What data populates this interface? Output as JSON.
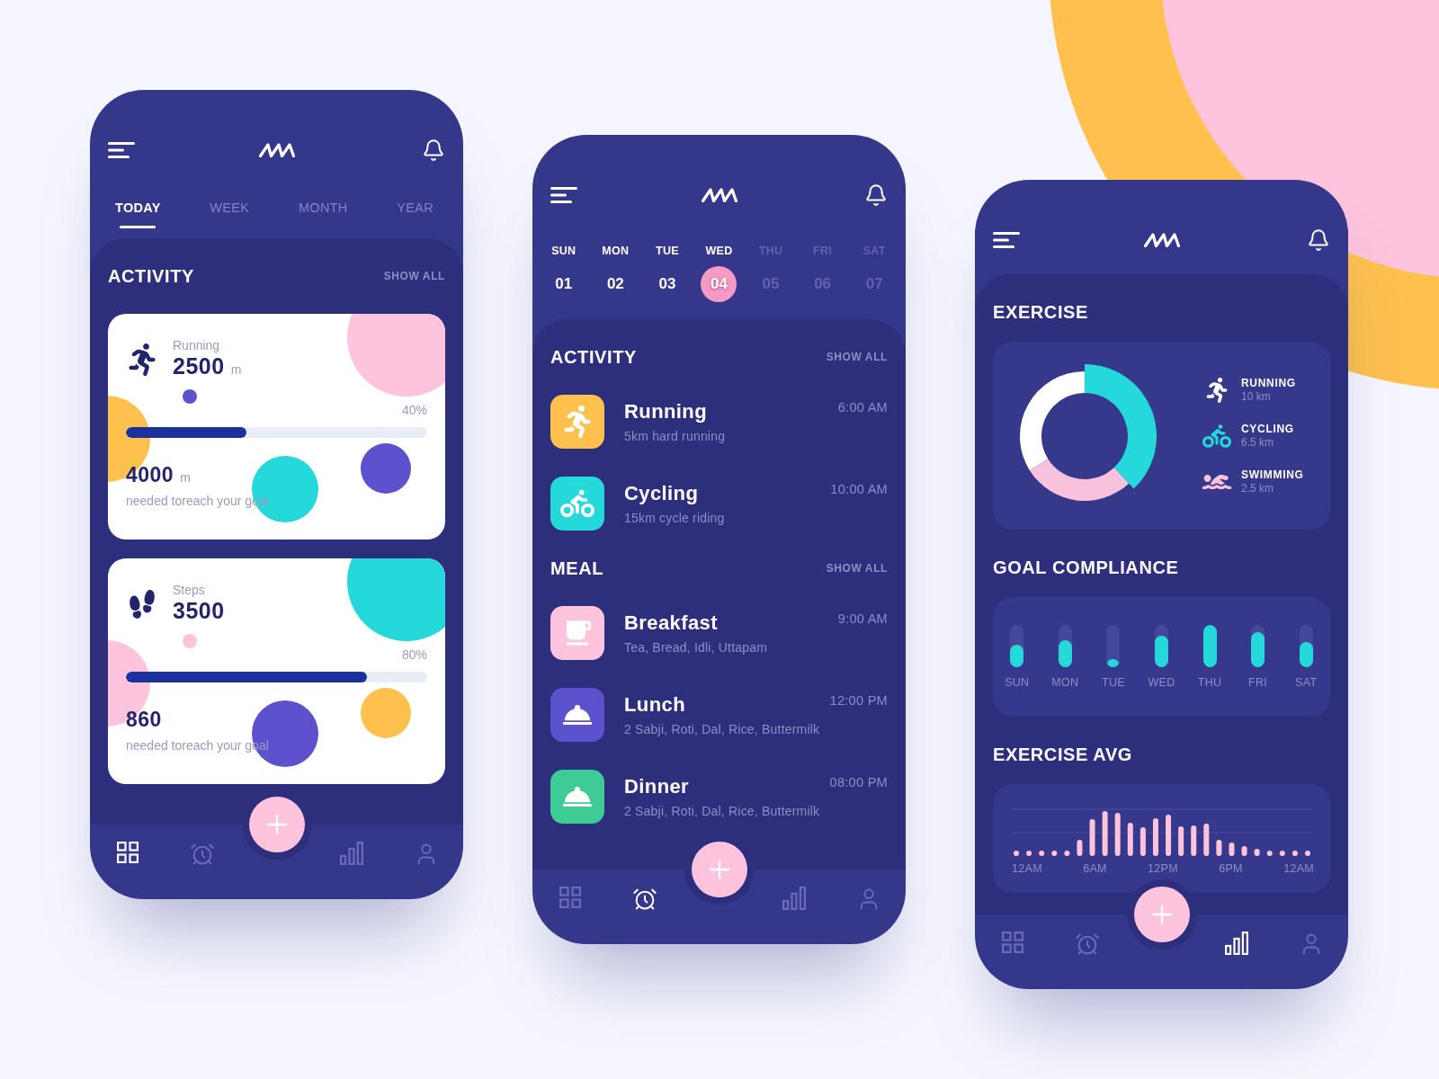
{
  "phones": [
    {
      "kind": "overview",
      "tabs": [
        {
          "label": "TODAY",
          "selected": true
        },
        {
          "label": "WEEK",
          "selected": false
        },
        {
          "label": "MONTH",
          "selected": false
        },
        {
          "label": "YEAR",
          "selected": false
        }
      ],
      "section": {
        "title": "ACTIVITY",
        "action": "SHOW ALL"
      },
      "cards": [
        {
          "label": "Running",
          "value": "2500",
          "unit": "m",
          "percent": "40%",
          "level": 0.4,
          "remaining": "4000",
          "remaining_unit": "m",
          "caption": "needed toreach your goal"
        },
        {
          "label": "Steps",
          "value": "3500",
          "percent": "80%",
          "level": 0.8,
          "remaining": "860",
          "caption": "needed toreach your goal"
        }
      ],
      "nav": [
        {
          "selected": true
        },
        {
          "selected": false
        },
        {
          "selected": false
        },
        {
          "selected": false
        }
      ]
    },
    {
      "kind": "schedule",
      "days": [
        {
          "name": "SUN",
          "date": "01",
          "selected": false,
          "dimmed": false
        },
        {
          "name": "MON",
          "date": "02",
          "selected": false,
          "dimmed": false
        },
        {
          "name": "TUE",
          "date": "03",
          "selected": false,
          "dimmed": false
        },
        {
          "name": "WED",
          "date": "04",
          "selected": true,
          "dimmed": false
        },
        {
          "name": "THU",
          "date": "05",
          "selected": false,
          "dimmed": true
        },
        {
          "name": "FRI",
          "date": "06",
          "selected": false,
          "dimmed": true
        },
        {
          "name": "SAT",
          "date": "07",
          "selected": false,
          "dimmed": true
        }
      ],
      "sections": [
        {
          "title": "ACTIVITY",
          "action": "SHOW ALL",
          "items": [
            {
              "title": "Running",
              "detail": "5km hard running",
              "time": "6:00 AM",
              "color": "#fec14e"
            },
            {
              "title": "Cycling",
              "detail": "15km cycle riding",
              "time": "10:00 AM",
              "color": "#25d8d9"
            }
          ]
        },
        {
          "title": "MEAL",
          "action": "SHOW ALL",
          "items": [
            {
              "title": "Breakfast",
              "detail": "Tea, Bread, Idli, Uttapam",
              "time": "9:00 AM",
              "color": "#fec4dd"
            },
            {
              "title": "Lunch",
              "detail": "2 Sabji, Roti, Dal, Rice, Buttermilk",
              "time": "12:00 PM",
              "color": "#5d52cd"
            },
            {
              "title": "Dinner",
              "detail": "2 Sabji, Roti, Dal, Rice, Buttermilk",
              "time": "08:00 PM",
              "color": "#3ecb95"
            }
          ]
        }
      ],
      "nav": [
        {
          "selected": false
        },
        {
          "selected": true
        },
        {
          "selected": false
        },
        {
          "selected": false
        }
      ]
    },
    {
      "kind": "statistics",
      "exercise": {
        "title": "EXERCISE",
        "legend": [
          {
            "label": "RUNNING",
            "value": "10 km",
            "color": "#ffffff"
          },
          {
            "label": "CYCLING",
            "value": "6.5 km",
            "color": "#25d8d9"
          },
          {
            "label": "SWIMMING",
            "value": "2.5 km",
            "color": "#f8c1dc"
          }
        ]
      },
      "goal_compliance": {
        "title": "GOAL COMPLIANCE",
        "days": [
          {
            "label": "SUN",
            "level": 0.54
          },
          {
            "label": "MON",
            "level": 0.63
          },
          {
            "label": "TUE",
            "level": 0.2
          },
          {
            "label": "WED",
            "level": 0.75
          },
          {
            "label": "THU",
            "level": 1
          },
          {
            "label": "FRI",
            "level": 0.82
          },
          {
            "label": "SAT",
            "level": 0.6
          }
        ]
      },
      "exercise_avg": {
        "title": "EXERCISE AVG",
        "axis_labels": [
          "12AM",
          "6AM",
          "12PM",
          "6PM",
          "12AM"
        ]
      },
      "nav": [
        {
          "selected": false
        },
        {
          "selected": false
        },
        {
          "selected": true
        },
        {
          "selected": false
        }
      ]
    }
  ]
}
